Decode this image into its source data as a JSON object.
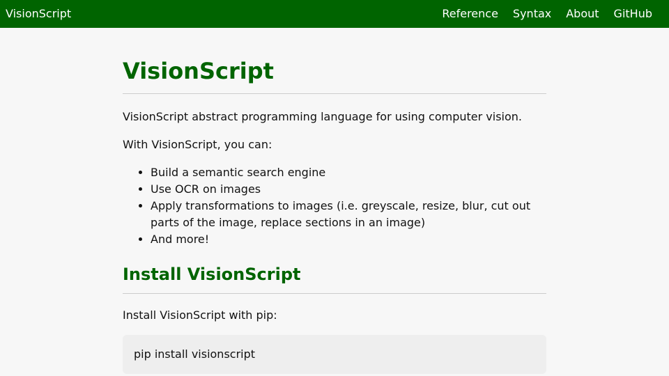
{
  "header": {
    "brand": "VisionScript",
    "nav": [
      {
        "label": "Reference"
      },
      {
        "label": "Syntax"
      },
      {
        "label": "About"
      },
      {
        "label": "GitHub"
      }
    ]
  },
  "main": {
    "title": "VisionScript",
    "intro": "VisionScript abstract programming language for using computer vision.",
    "can_text": "With VisionScript, you can:",
    "features": [
      "Build a semantic search engine",
      "Use OCR on images",
      "Apply transformations to images (i.e. greyscale, resize, blur, cut out parts of the image, replace sections in an image)",
      "And more!"
    ],
    "install_heading": "Install VisionScript",
    "install_text": "Install VisionScript with pip:",
    "install_command": "pip install visionscript"
  },
  "colors": {
    "header_bg": "#006400",
    "heading": "#006400",
    "page_bg": "#f7f7f7",
    "code_bg": "#eeeeee"
  }
}
